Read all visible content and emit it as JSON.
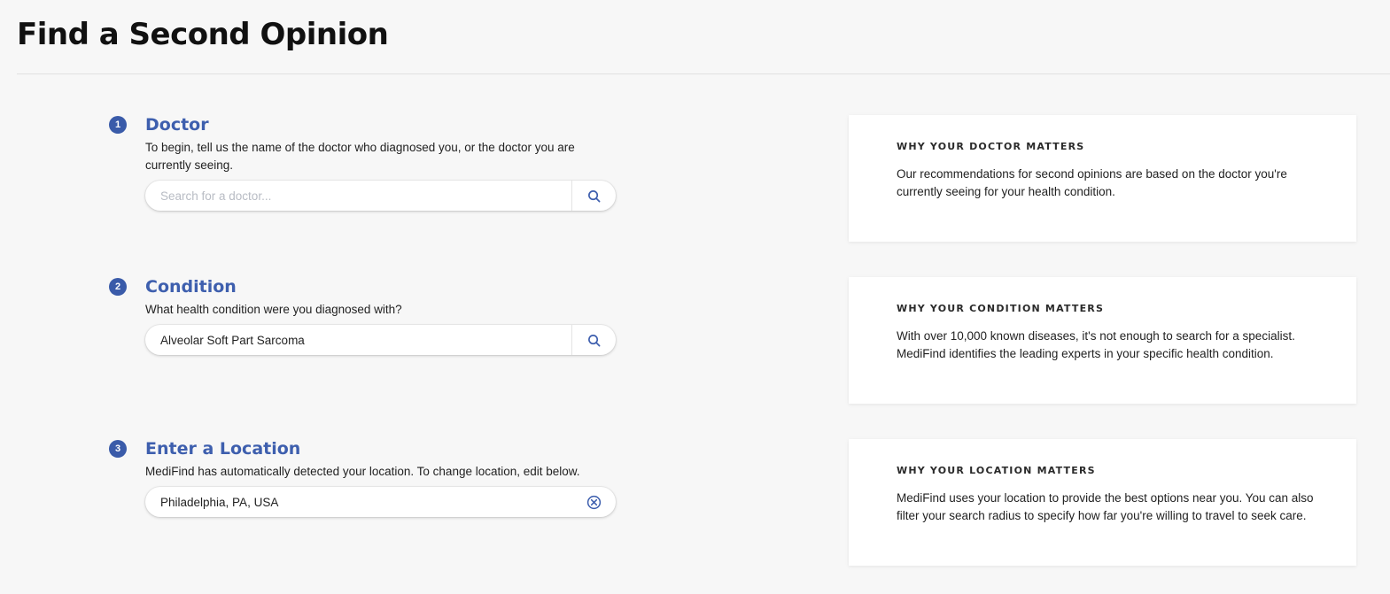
{
  "page": {
    "title": "Find a Second Opinion"
  },
  "steps": [
    {
      "number": "1",
      "title": "Doctor",
      "description": "To begin, tell us the name of the doctor who diagnosed you, or the doctor you are currently seeing.",
      "input_value": "",
      "input_placeholder": "Search for a doctor...",
      "action_icon": "search-icon"
    },
    {
      "number": "2",
      "title": "Condition",
      "description": "What health condition were you diagnosed with?",
      "input_value": "Alveolar Soft Part Sarcoma",
      "input_placeholder": "",
      "action_icon": "search-icon"
    },
    {
      "number": "3",
      "title": "Enter a Location",
      "description": "MediFind has automatically detected your location. To change location, edit below.",
      "input_value": "Philadelphia, PA, USA",
      "input_placeholder": "",
      "action_icon": "clear-circle-icon"
    }
  ],
  "info_cards": [
    {
      "heading": "WHY YOUR DOCTOR MATTERS",
      "body": "Our recommendations for second opinions are based on the doctor you're currently seeing for your health condition."
    },
    {
      "heading": "WHY YOUR CONDITION MATTERS",
      "body": "With over 10,000 known diseases, it's not enough to search for a specialist. MediFind identifies the leading experts in your specific health condition."
    },
    {
      "heading": "WHY YOUR LOCATION MATTERS",
      "body": "MediFind uses your location to provide the best options near you. You can also filter your search radius to specify how far you're willing to travel to seek care."
    }
  ],
  "colors": {
    "accent": "#3e5fae",
    "badge": "#3a5ba9",
    "background": "#f7f7f7"
  }
}
